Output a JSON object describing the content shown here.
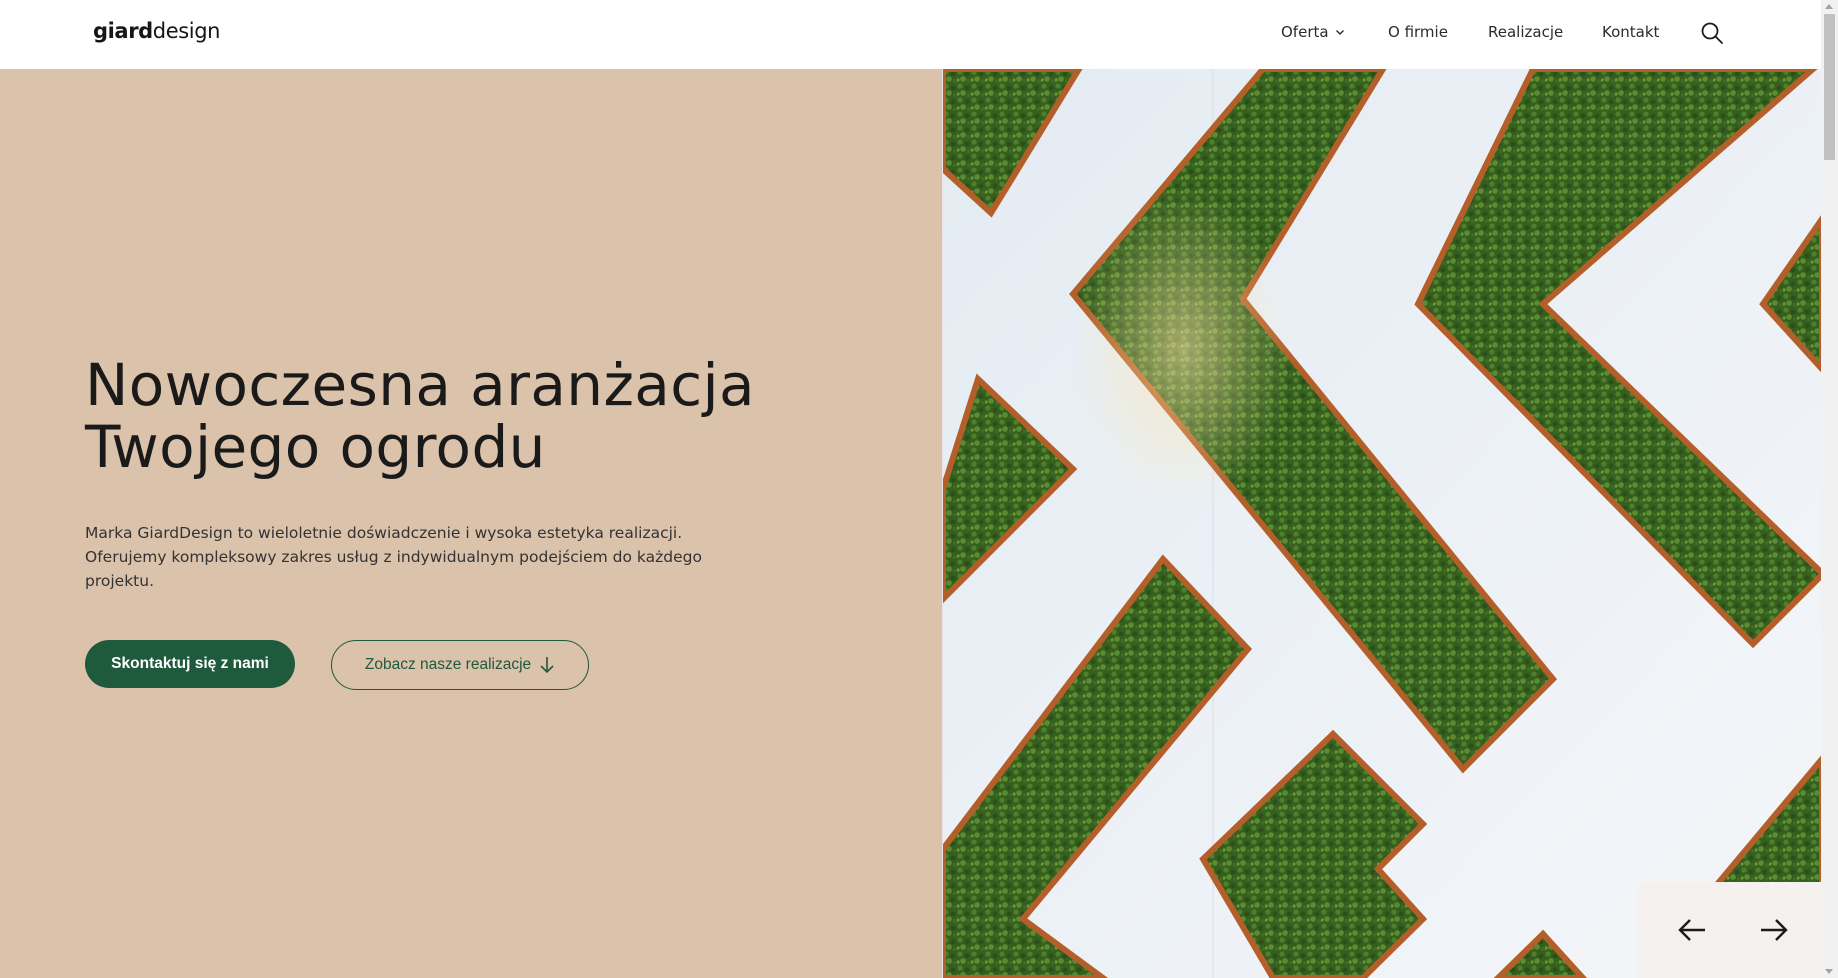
{
  "brand": {
    "logo_bold": "giard",
    "logo_light": "design"
  },
  "nav": {
    "items": [
      {
        "label": "Oferta",
        "has_dropdown": true
      },
      {
        "label": "O firmie"
      },
      {
        "label": "Realizacje"
      },
      {
        "label": "Kontakt"
      }
    ],
    "search_icon": "search-icon"
  },
  "hero": {
    "title_line1": "Nowoczesna aranżacja",
    "title_line2": "Twojego ogrodu",
    "description": "Marka GiardDesign to wieloletnie doświadczenie i wysoka estetyka realizacji. Oferujemy kompleksowy zakres usług z indywidualnym podejściem do każdego projektu.",
    "primary_cta": "Skontaktuj się z nami",
    "secondary_cta": "Zobacz nasze realizacje",
    "secondary_cta_icon": "arrow-down-icon"
  },
  "slider": {
    "prev_icon": "arrow-left-icon",
    "next_icon": "arrow-right-icon"
  },
  "colors": {
    "hero_bg": "#dbc2ab",
    "accent_green": "#1e5a3b",
    "planter_wood": "#b45f2a",
    "foliage": "#3f6b25",
    "wall": "#eef2f6"
  }
}
